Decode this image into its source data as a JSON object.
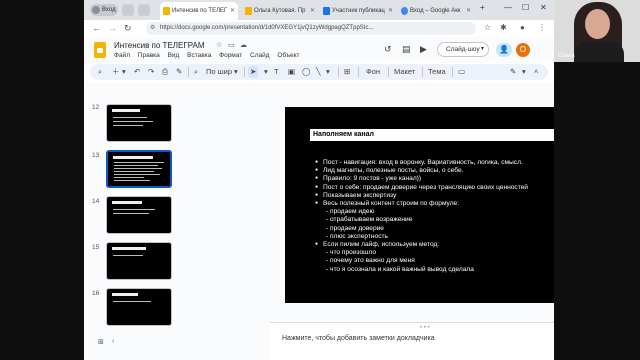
{
  "browser": {
    "profile_label": "Вход",
    "tabs": [
      {
        "label": "Интенсив по ТЕЛЕГ",
        "active": true,
        "color": "#f4b400"
      },
      {
        "label": "Ольга Кутовая. Пр",
        "active": false,
        "color": "#f4b400"
      },
      {
        "label": "Участник публикац",
        "active": false,
        "color": "#1a73e8"
      },
      {
        "label": "Вход – Google Акк",
        "active": false,
        "color": "#4285f4"
      }
    ],
    "new_tab": "+",
    "url": "https://docs.google.com/presentation/d/1d0fVXEGY1jvQ1zyWdgpagQZTppStc..."
  },
  "docs": {
    "title": "Интенсив по ТЕЛЕГРАМ",
    "menu": [
      "Файл",
      "Правка",
      "Вид",
      "Вставка",
      "Формат",
      "Слайд",
      "Объект"
    ],
    "slideshow_label": "Слайд-шоу",
    "avatar_initial": "О"
  },
  "toolbar": {
    "zoom_label": "По шир",
    "background_label": "Фон",
    "layout_label": "Макет",
    "theme_label": "Тема"
  },
  "filmstrip": {
    "slide_numbers": [
      "12",
      "13",
      "14",
      "15",
      "16"
    ],
    "selected": "13"
  },
  "slide": {
    "title": "Наполняем канал",
    "lines": [
      {
        "text": "Пост - навигация: вход в воронку. Вариативность, логика, смысл.",
        "type": "bullet"
      },
      {
        "text": "Лид магниты, полезные посты, войсы, о себе.",
        "type": "bullet"
      },
      {
        "text": "Правило: 9 постов - уже канал))",
        "type": "bullet"
      },
      {
        "text": "Пост о себе: продаем доверие через трансляцию своих ценностей",
        "type": "bullet"
      },
      {
        "text": "Показываем экспертизу",
        "type": "bullet"
      },
      {
        "text": "Весь полезный контент строим по формуле:",
        "type": "bullet"
      },
      {
        "text": "- продаем идею",
        "type": "sub"
      },
      {
        "text": "- отрабатываем возражение",
        "type": "sub"
      },
      {
        "text": "- продаем доверие",
        "type": "sub"
      },
      {
        "text": "- плюс экспертность",
        "type": "sub"
      },
      {
        "text": "Если пилим лайф, используем метод:",
        "type": "bullet"
      },
      {
        "text": "- что произошло",
        "type": "sub"
      },
      {
        "text": "- почему это важно для меня",
        "type": "sub"
      },
      {
        "text": "- что я осознала и какой важный вывод сделала",
        "type": "sub"
      }
    ]
  },
  "notes": {
    "placeholder": "Нажмите, чтобы добавить заметки докладчика"
  },
  "webcam": {
    "name": "Ольга"
  }
}
